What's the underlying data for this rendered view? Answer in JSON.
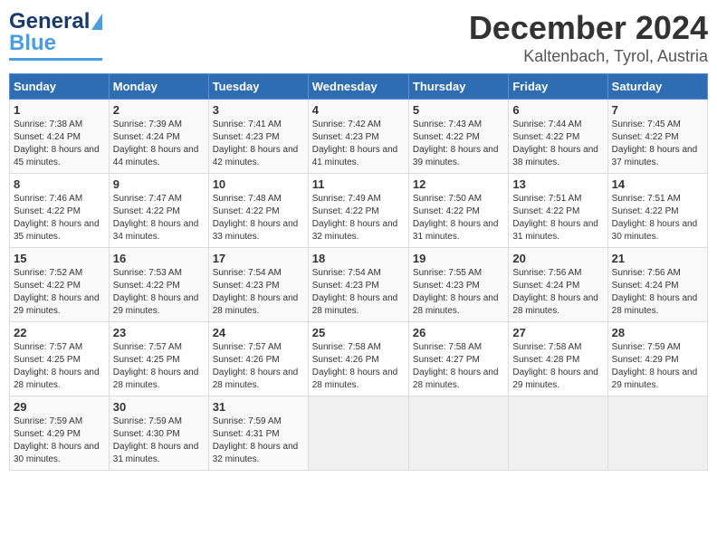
{
  "header": {
    "logo_line1": "General",
    "logo_line2": "Blue",
    "title": "December 2024",
    "subtitle": "Kaltenbach, Tyrol, Austria"
  },
  "days_of_week": [
    "Sunday",
    "Monday",
    "Tuesday",
    "Wednesday",
    "Thursday",
    "Friday",
    "Saturday"
  ],
  "weeks": [
    [
      {
        "day": "1",
        "sunrise": "7:38 AM",
        "sunset": "4:24 PM",
        "daylight": "8 hours and 45 minutes."
      },
      {
        "day": "2",
        "sunrise": "7:39 AM",
        "sunset": "4:24 PM",
        "daylight": "8 hours and 44 minutes."
      },
      {
        "day": "3",
        "sunrise": "7:41 AM",
        "sunset": "4:23 PM",
        "daylight": "8 hours and 42 minutes."
      },
      {
        "day": "4",
        "sunrise": "7:42 AM",
        "sunset": "4:23 PM",
        "daylight": "8 hours and 41 minutes."
      },
      {
        "day": "5",
        "sunrise": "7:43 AM",
        "sunset": "4:22 PM",
        "daylight": "8 hours and 39 minutes."
      },
      {
        "day": "6",
        "sunrise": "7:44 AM",
        "sunset": "4:22 PM",
        "daylight": "8 hours and 38 minutes."
      },
      {
        "day": "7",
        "sunrise": "7:45 AM",
        "sunset": "4:22 PM",
        "daylight": "8 hours and 37 minutes."
      }
    ],
    [
      {
        "day": "8",
        "sunrise": "7:46 AM",
        "sunset": "4:22 PM",
        "daylight": "8 hours and 35 minutes."
      },
      {
        "day": "9",
        "sunrise": "7:47 AM",
        "sunset": "4:22 PM",
        "daylight": "8 hours and 34 minutes."
      },
      {
        "day": "10",
        "sunrise": "7:48 AM",
        "sunset": "4:22 PM",
        "daylight": "8 hours and 33 minutes."
      },
      {
        "day": "11",
        "sunrise": "7:49 AM",
        "sunset": "4:22 PM",
        "daylight": "8 hours and 32 minutes."
      },
      {
        "day": "12",
        "sunrise": "7:50 AM",
        "sunset": "4:22 PM",
        "daylight": "8 hours and 31 minutes."
      },
      {
        "day": "13",
        "sunrise": "7:51 AM",
        "sunset": "4:22 PM",
        "daylight": "8 hours and 31 minutes."
      },
      {
        "day": "14",
        "sunrise": "7:51 AM",
        "sunset": "4:22 PM",
        "daylight": "8 hours and 30 minutes."
      }
    ],
    [
      {
        "day": "15",
        "sunrise": "7:52 AM",
        "sunset": "4:22 PM",
        "daylight": "8 hours and 29 minutes."
      },
      {
        "day": "16",
        "sunrise": "7:53 AM",
        "sunset": "4:22 PM",
        "daylight": "8 hours and 29 minutes."
      },
      {
        "day": "17",
        "sunrise": "7:54 AM",
        "sunset": "4:23 PM",
        "daylight": "8 hours and 28 minutes."
      },
      {
        "day": "18",
        "sunrise": "7:54 AM",
        "sunset": "4:23 PM",
        "daylight": "8 hours and 28 minutes."
      },
      {
        "day": "19",
        "sunrise": "7:55 AM",
        "sunset": "4:23 PM",
        "daylight": "8 hours and 28 minutes."
      },
      {
        "day": "20",
        "sunrise": "7:56 AM",
        "sunset": "4:24 PM",
        "daylight": "8 hours and 28 minutes."
      },
      {
        "day": "21",
        "sunrise": "7:56 AM",
        "sunset": "4:24 PM",
        "daylight": "8 hours and 28 minutes."
      }
    ],
    [
      {
        "day": "22",
        "sunrise": "7:57 AM",
        "sunset": "4:25 PM",
        "daylight": "8 hours and 28 minutes."
      },
      {
        "day": "23",
        "sunrise": "7:57 AM",
        "sunset": "4:25 PM",
        "daylight": "8 hours and 28 minutes."
      },
      {
        "day": "24",
        "sunrise": "7:57 AM",
        "sunset": "4:26 PM",
        "daylight": "8 hours and 28 minutes."
      },
      {
        "day": "25",
        "sunrise": "7:58 AM",
        "sunset": "4:26 PM",
        "daylight": "8 hours and 28 minutes."
      },
      {
        "day": "26",
        "sunrise": "7:58 AM",
        "sunset": "4:27 PM",
        "daylight": "8 hours and 28 minutes."
      },
      {
        "day": "27",
        "sunrise": "7:58 AM",
        "sunset": "4:28 PM",
        "daylight": "8 hours and 29 minutes."
      },
      {
        "day": "28",
        "sunrise": "7:59 AM",
        "sunset": "4:29 PM",
        "daylight": "8 hours and 29 minutes."
      }
    ],
    [
      {
        "day": "29",
        "sunrise": "7:59 AM",
        "sunset": "4:29 PM",
        "daylight": "8 hours and 30 minutes."
      },
      {
        "day": "30",
        "sunrise": "7:59 AM",
        "sunset": "4:30 PM",
        "daylight": "8 hours and 31 minutes."
      },
      {
        "day": "31",
        "sunrise": "7:59 AM",
        "sunset": "4:31 PM",
        "daylight": "8 hours and 32 minutes."
      },
      null,
      null,
      null,
      null
    ]
  ],
  "labels": {
    "sunrise": "Sunrise:",
    "sunset": "Sunset:",
    "daylight": "Daylight:"
  }
}
